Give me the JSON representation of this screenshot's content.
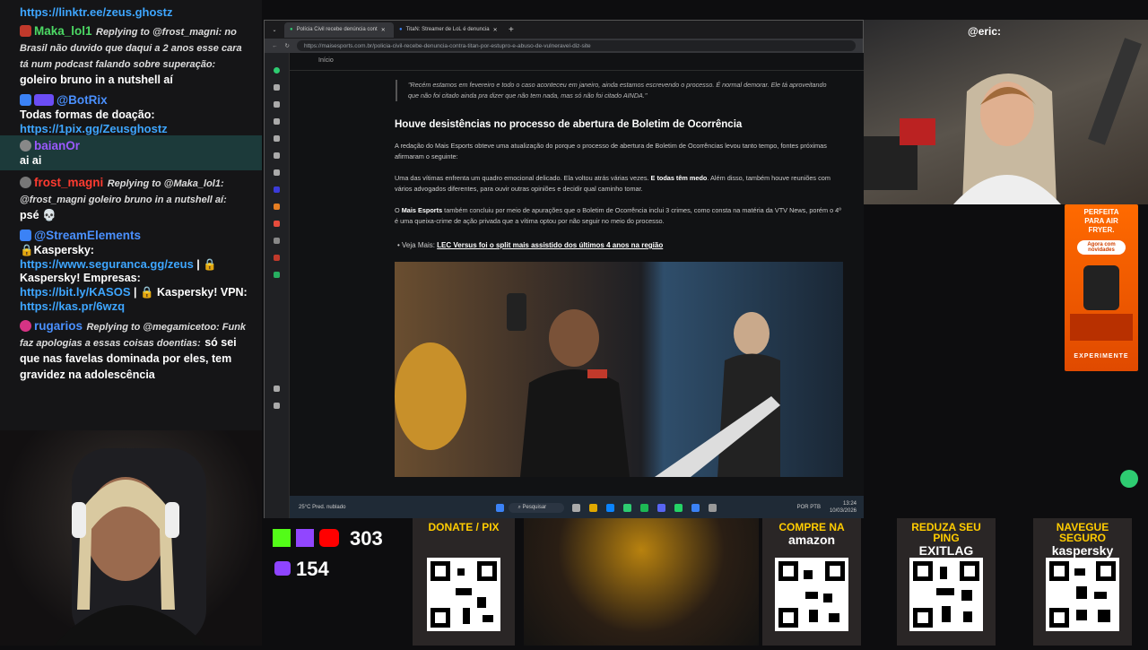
{
  "chat": {
    "top_link": "https://linktr.ee/zeus.ghostz",
    "messages": [
      {
        "user": "Maka_lol1",
        "color": "#4cd964",
        "reply": "Replying to @frost_magni: no Brasil não duvido que daqui a 2 anos esse cara tá num podcast falando sobre superação:",
        "text": "goleiro bruno in a nutshell aí"
      },
      {
        "user": "@BotRix",
        "color": "#4a90ff",
        "text": "Todas formas de doação:",
        "link": "https://1pix.gg/Zeusghostz"
      },
      {
        "user": "baianOr",
        "color": "#9b59ff",
        "text": "ai ai"
      },
      {
        "user": "frost_magni",
        "color": "#ff3b30",
        "reply": "Replying to @Maka_lol1: @frost_magni goleiro bruno in a nutshell aí:",
        "text": "psé 💀"
      },
      {
        "user": "@StreamElements",
        "color": "#4a90ff",
        "lines": [
          "🔒Kaspersky:",
          "https://www.seguranca.gg/zeus",
          " | 🔒 Kaspersky! Empresas:",
          "https://bit.ly/KASOS",
          " | 🔒 Kaspersky! VPN:",
          "https://kas.pr/6wzq"
        ]
      },
      {
        "user": "rugarios",
        "color": "#4a90ff",
        "reply": "Replying to @megamicetoo: Funk faz apologias a essas coisas doentias:",
        "text": "só sei que nas favelas dominada por eles, tem gravidez na adolescência"
      }
    ]
  },
  "browser": {
    "tabs": [
      {
        "label": "Polícia Civil recebe denúncia cont",
        "active": true
      },
      {
        "label": "TitaN: Streamer de LoL é denuncia",
        "active": false
      }
    ],
    "url": "https://maisesports.com.br/policia-civil-recebe-denuncia-contra-titan-por-estupro-e-abuso-de-vulneravel-diz-site",
    "topnav": "Início",
    "article": {
      "quote": "\"Recém estamos em fevereiro e todo o caso aconteceu em janeiro, ainda estamos escrevendo o processo. É normal demorar. Ele tá aproveitando que não foi citado ainda pra dizer que não tem nada, mas só não foi citado AINDA.\"",
      "heading": "Houve desistências no processo de abertura de Boletim de Ocorrência",
      "p1": "A redação do Mais Esports obteve uma atualização do porque o processo de abertura de Boletim de Ocorrências levou tanto tempo, fontes próximas afirmaram o seguinte:",
      "p2a": "Uma das vítimas enfrenta um quadro emocional delicado. Ela voltou atrás várias vezes.",
      "p2b": "E todas têm medo",
      "p2c": ". Além disso, também houve reuniões com vários advogados diferentes, para ouvir outras opiniões e decidir qual caminho tomar.",
      "p3a": "O",
      "p3b": "Mais Esports",
      "p3c": "também concluiu por meio de apurações que o Boletim de Ocorrência inclui 3 crimes, como consta na matéria da VTV News, porém o 4º é uma queixa-crime de ação privada que a vítima optou por não seguir no meio do processo.",
      "see_more_prefix": "Veja Mais:",
      "see_more_link": "LEC Versus foi o split mais assistido dos últimos 4 anos na região"
    },
    "taskbar": {
      "weather_temp": "25°C",
      "weather_desc": "Pred. nublado",
      "search": "Pesquisar",
      "lang": "POR PTB",
      "time": "13:24",
      "date": "10/03/2026"
    }
  },
  "overlay": {
    "cam_handle": "@eric:",
    "ad": {
      "line1": "PERFEITA",
      "line2": "PARA AIR",
      "line3": "FRYER.",
      "badge": "Agora com novidades",
      "cta": "EXPERIMENTE"
    },
    "stats": {
      "youtube": "303",
      "kick_twitch_icons": [
        "kick-icon",
        "twitch-icon",
        "youtube-icon"
      ],
      "secondary": "154"
    },
    "qr_panels": [
      {
        "title": "DONATE / PIX"
      },
      {
        "title": "COMPRE NA",
        "subtitle": "amazon"
      },
      {
        "title": "REDUZA SEU PING",
        "subtitle": "EXITLAG"
      },
      {
        "title": "NAVEGUE SEGURO",
        "subtitle": "kaspersky"
      }
    ]
  }
}
